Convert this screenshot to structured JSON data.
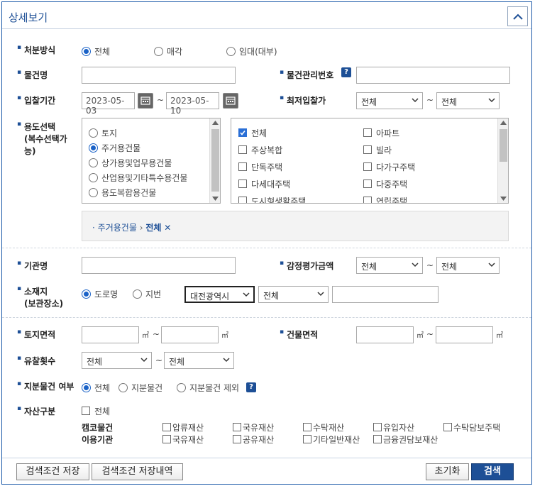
{
  "header": {
    "title": "상세보기"
  },
  "disposal": {
    "label": "처분방식",
    "options": [
      "전체",
      "매각",
      "임대(대부)"
    ]
  },
  "itemName": {
    "label": "물건명",
    "value": ""
  },
  "itemNumber": {
    "label": "물건관리번호",
    "value": ""
  },
  "bidPeriod": {
    "label": "입찰기간",
    "from": "2023-05-03",
    "to": "2023-05-10",
    "tilde": "~"
  },
  "minBid": {
    "label": "최저입찰가",
    "from": "전체",
    "to": "전체"
  },
  "usage": {
    "label": "용도선택",
    "label2": "(복수선택가",
    "label3": "능)",
    "categories": [
      "토지",
      "주거용건물",
      "상가용및업무용건물",
      "산업용및기타특수용건물",
      "용도복합용건물"
    ],
    "subLeft": [
      "전체",
      "주상복합",
      "단독주택",
      "다세대주택",
      "도시형생활주택"
    ],
    "subRight": [
      "아파트",
      "빌라",
      "다가구주택",
      "다중주택",
      "연립주택"
    ],
    "selectedCategory": "주거용건물",
    "selectedSub": "전체",
    "breadcrumbArrow": "›"
  },
  "agency": {
    "label": "기관명",
    "value": ""
  },
  "appraisal": {
    "label": "감정평가금액",
    "from": "전체",
    "to": "전체"
  },
  "location": {
    "label": "소재지",
    "label2": "(보관장소)",
    "options": [
      "도로명",
      "지번"
    ],
    "city": "대전광역시",
    "district": "전체",
    "detail": ""
  },
  "landArea": {
    "label": "토지면적",
    "unit": "㎡"
  },
  "buildingArea": {
    "label": "건물면적",
    "unit": "㎡"
  },
  "failCount": {
    "label": "유찰횟수",
    "from": "전체",
    "to": "전체"
  },
  "shareItem": {
    "label": "지분물건 여부",
    "options": [
      "전체",
      "지분물건",
      "지분물건 제외"
    ]
  },
  "assetType": {
    "label": "자산구분",
    "all": "전체",
    "row1Label": "캠코물건",
    "row1": [
      "압류재산",
      "국유재산",
      "수탁재산",
      "유입자산",
      "수탁담보주택"
    ],
    "row2Label": "이용기관",
    "row2": [
      "국유재산",
      "공유재산",
      "기타일반재산",
      "금융권담보재산"
    ]
  },
  "footer": {
    "saveCondition": "검색조건 저장",
    "saveHistory": "검색조건 저장내역",
    "reset": "초기화",
    "search": "검색"
  }
}
